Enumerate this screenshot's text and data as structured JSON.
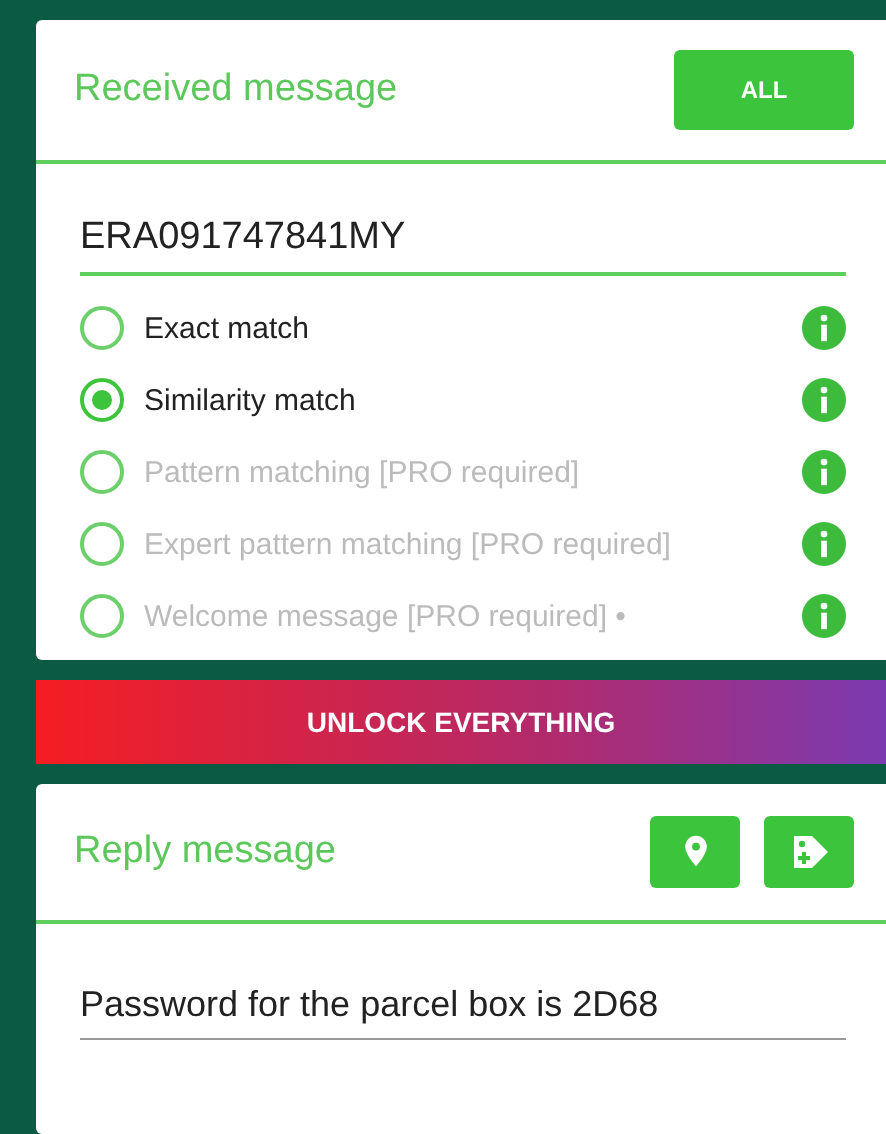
{
  "received": {
    "title": "Received message",
    "all_button": "ALL",
    "value": "ERA091747841MY",
    "options": [
      {
        "label": "Exact match",
        "selected": false,
        "disabled": false
      },
      {
        "label": "Similarity match",
        "selected": true,
        "disabled": false
      },
      {
        "label": "Pattern matching [PRO required]",
        "selected": false,
        "disabled": true
      },
      {
        "label": "Expert pattern matching [PRO required]",
        "selected": false,
        "disabled": true
      },
      {
        "label": "Welcome message [PRO required] •",
        "selected": false,
        "disabled": true
      }
    ]
  },
  "unlock_button": "UNLOCK EVERYTHING",
  "reply": {
    "title": "Reply message",
    "value": "Password for the parcel box is 2D68"
  }
}
